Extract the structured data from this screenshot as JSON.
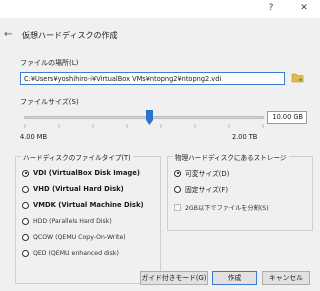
{
  "window": {
    "help_glyph": "?",
    "close_glyph": "✕"
  },
  "dialog": {
    "back_glyph": "←",
    "title": "仮想ハードディスクの作成"
  },
  "file_location": {
    "label": "ファイルの場所(L)",
    "value": "C:¥Users¥yoshihiro-i¥VirtualBox VMs¥ntopng2¥ntopng2.vdi",
    "icon": "folder-icon"
  },
  "file_size": {
    "label": "ファイルサイズ(S)",
    "value": "10.00 GB",
    "min_label": "4.00 MB",
    "max_label": "2.00 TB"
  },
  "file_type": {
    "label": "ハードディスクのファイルタイプ(T)",
    "options": [
      {
        "label": "VDI (VirtualBox Disk Image)",
        "selected": true
      },
      {
        "label": "VHD (Virtual Hard Disk)",
        "selected": false
      },
      {
        "label": "VMDK (Virtual Machine Disk)",
        "selected": false
      },
      {
        "label": "HDD (Parallels Hard Disk)",
        "selected": false
      },
      {
        "label": "QCOW (QEMU Copy-On-Write)",
        "selected": false
      },
      {
        "label": "QED (QEMU enhanced disk)",
        "selected": false
      }
    ]
  },
  "storage": {
    "label": "物理ハードディスクにあるストレージ",
    "options": [
      {
        "label": "可変サイズ(D)",
        "selected": true
      },
      {
        "label": "固定サイズ(F)",
        "selected": false
      }
    ],
    "split_label": "2GB以下でファイルを分割(S)"
  },
  "buttons": {
    "guided": "ガイド付きモード(G)",
    "create": "作成",
    "cancel": "キャンセル"
  },
  "colors": {
    "accent": "#3b7bd4",
    "folder": "#e8b84a",
    "thumb": "#2a73c9"
  }
}
